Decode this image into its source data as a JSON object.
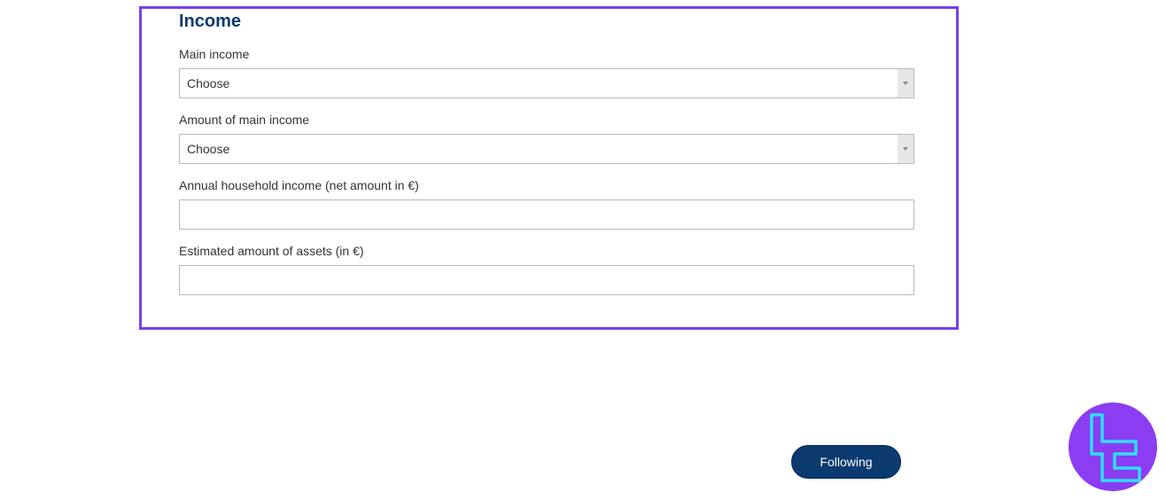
{
  "section": {
    "title": "Income"
  },
  "fields": {
    "main_income": {
      "label": "Main income",
      "value": "Choose"
    },
    "main_income_amount": {
      "label": "Amount of main income",
      "value": "Choose"
    },
    "household_income": {
      "label": "Annual household income (net amount in €)",
      "value": ""
    },
    "assets": {
      "label": "Estimated amount of assets (in €)",
      "value": ""
    }
  },
  "actions": {
    "next_label": "Following"
  },
  "icons": {
    "select_arrow": "chevron-down-icon",
    "watermark": "tradingfinder-logo-icon"
  },
  "colors": {
    "title": "#0b3a70",
    "button": "#0b3a70",
    "highlight": "#7b3fe4",
    "logo_bg": "#8b3df2",
    "logo_fg": "#2de0ff"
  }
}
